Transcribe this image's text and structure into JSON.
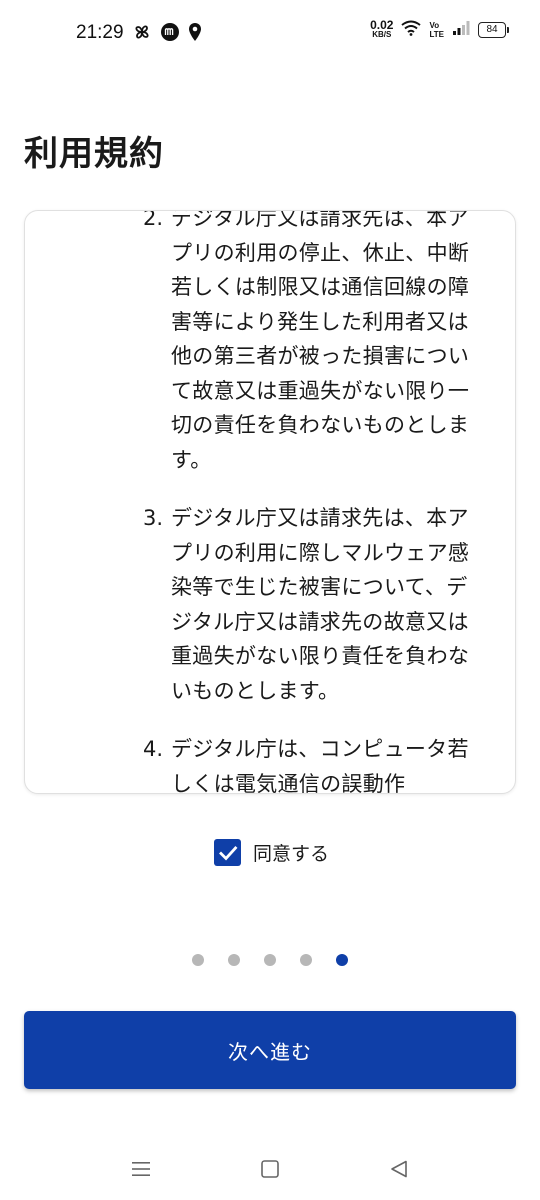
{
  "status_bar": {
    "time": "21:29",
    "net_speed_value": "0.02",
    "net_speed_unit": "KB/S",
    "volte_top": "Vo",
    "volte_bottom": "LTE",
    "battery": "84"
  },
  "page": {
    "title": "利用規約"
  },
  "terms": {
    "items": [
      {
        "number": "2.",
        "text": "デジタル庁又は請求先は、本アプリの利用の停止、休止、中断若しくは制限又は通信回線の障害等により発生した利用者又は他の第三者が被った損害について故意又は重過失がない限り一切の責任を負わないものとします。"
      },
      {
        "number": "3.",
        "text": "デジタル庁又は請求先は、本アプリの利用に際しマルウェア感染等で生じた被害について、デジタル庁又は請求先の故意又は重過失がない限り責任を負わないものとします。"
      },
      {
        "number": "4.",
        "text": "デジタル庁は、コンピュータ若しくは電気通信の誤動作"
      }
    ]
  },
  "agree": {
    "label": "同意する",
    "checked": true
  },
  "pagination": {
    "total": 5,
    "current": 5
  },
  "next_button": {
    "label": "次へ進む"
  },
  "colors": {
    "accent": "#0f3fa8",
    "dot_inactive": "#b7b7b7"
  },
  "nav_bar": {
    "icons": [
      "menu-icon",
      "home-square-icon",
      "back-triangle-icon"
    ]
  }
}
